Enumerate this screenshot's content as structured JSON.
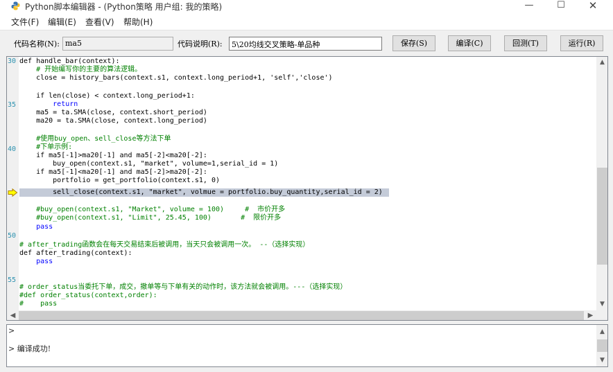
{
  "window": {
    "title": "Python脚本编辑器 - (Python策略 用户组: 我的策略)",
    "minimize_glyph": "—",
    "maximize_glyph": "☐",
    "close_glyph": "✕"
  },
  "menu": {
    "items": [
      "文件(F)",
      "编辑(E)",
      "查看(V)",
      "帮助(H)"
    ]
  },
  "toolbar": {
    "code_name_label": "代码名称(N):",
    "code_name_value": "ma5",
    "code_desc_label": "代码说明(R):",
    "code_desc_value": "5\\20均线交叉策略-单品种",
    "save_label": "保存(S)",
    "compile_label": "编译(C)",
    "backtest_label": "回测(T)",
    "run_label": "运行(R)"
  },
  "editor": {
    "line_numbers": [
      "30",
      "35",
      "40",
      "50",
      "55"
    ],
    "current_line_marker": "arrow-right-icon",
    "code": {
      "l01": "def handle_bar(context):",
      "l02": "    # 开始编写你的主要的算法逻辑。",
      "l03": "    close = history_bars(context.s1, context.long_period+1, 'self','close')",
      "l04": "",
      "l05": "    if len(close) < context.long_period+1:",
      "l06": "        return",
      "l07": "    ma5 = ta.SMA(close, context.short_period)",
      "l08": "    ma20 = ta.SMA(close, context.long_period)",
      "l09": "",
      "l10": "    #使用buy_open、sell_close等方法下单",
      "l11": "    #下单示例:",
      "l12": "    if ma5[-1]>ma20[-1] and ma5[-2]<ma20[-2]:",
      "l13": "        buy_open(context.s1, \"market\", volume=1,serial_id = 1)",
      "l14": "    if ma5[-1]<ma20[-1] and ma5[-2]>ma20[-2]:",
      "l15": "        portfolio = get_portfolio(context.s1, 0)",
      "l16": "        sell_close(context.s1, \"market\", volmue = portfolio.buy_quantity,serial_id = 2)",
      "l17": "",
      "l18": "    #buy_open(context.s1, \"Market\", volume = 100)     #  市价开多",
      "l19": "    #buy_open(context.s1, \"Limit\", 25.45, 100)       #  限价开多",
      "l20": "    pass",
      "l21": "",
      "l22": "# after_trading函数会在每天交易结束后被调用，当天只会被调用一次。 --（选择实现）",
      "l23": "def after_trading(context):",
      "l24": "    pass",
      "l25": "",
      "l26": "",
      "l27": "# order_status当委托下单，成交，撤单等与下单有关的动作时，该方法就会被调用。---（选择实现）",
      "l28": "#def order_status(context,order):",
      "l29": "#    pass"
    }
  },
  "output": {
    "prompt1": ">",
    "result": "> 编译成功!"
  }
}
